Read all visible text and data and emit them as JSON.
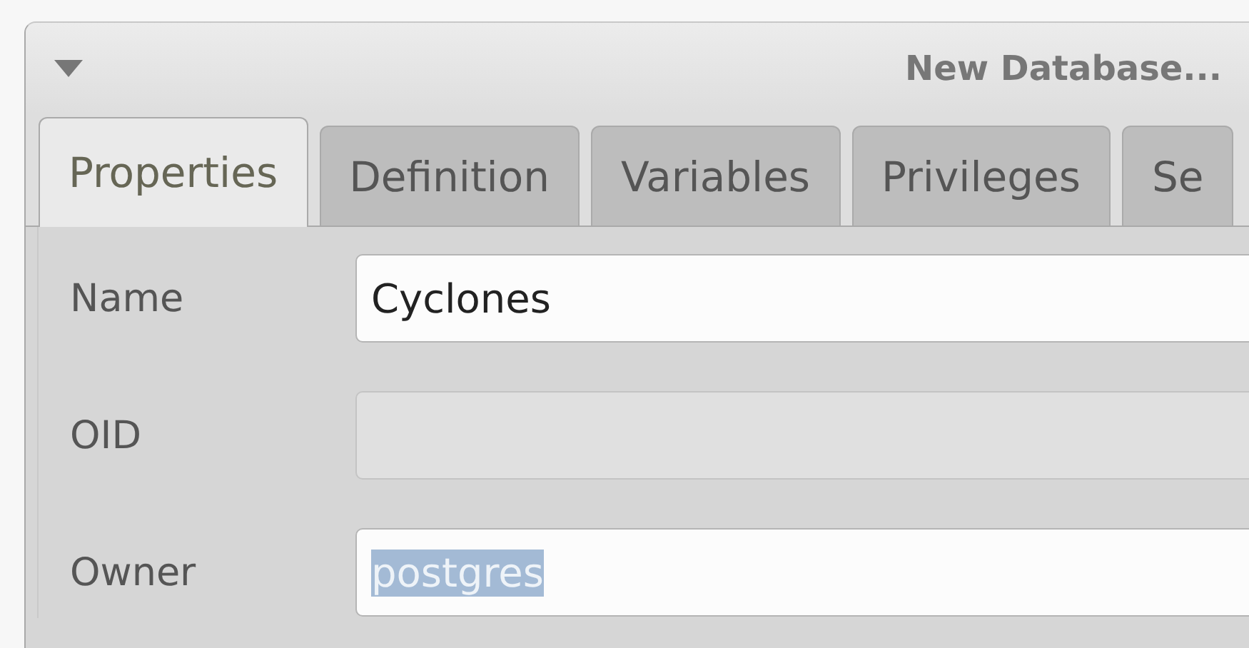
{
  "window": {
    "title": "New Database..."
  },
  "tabs": [
    {
      "label": "Properties",
      "selected": true
    },
    {
      "label": "Definition",
      "selected": false
    },
    {
      "label": "Variables",
      "selected": false
    },
    {
      "label": "Privileges",
      "selected": false
    },
    {
      "label": "Se",
      "selected": false
    }
  ],
  "fields": [
    {
      "label": "Name",
      "value": "Cyclones",
      "disabled": false,
      "text_selected": false
    },
    {
      "label": "OID",
      "disabled": true,
      "text_selected": false
    },
    {
      "label": "Owner",
      "value": "postgres",
      "disabled": false,
      "text_selected": true
    }
  ]
}
